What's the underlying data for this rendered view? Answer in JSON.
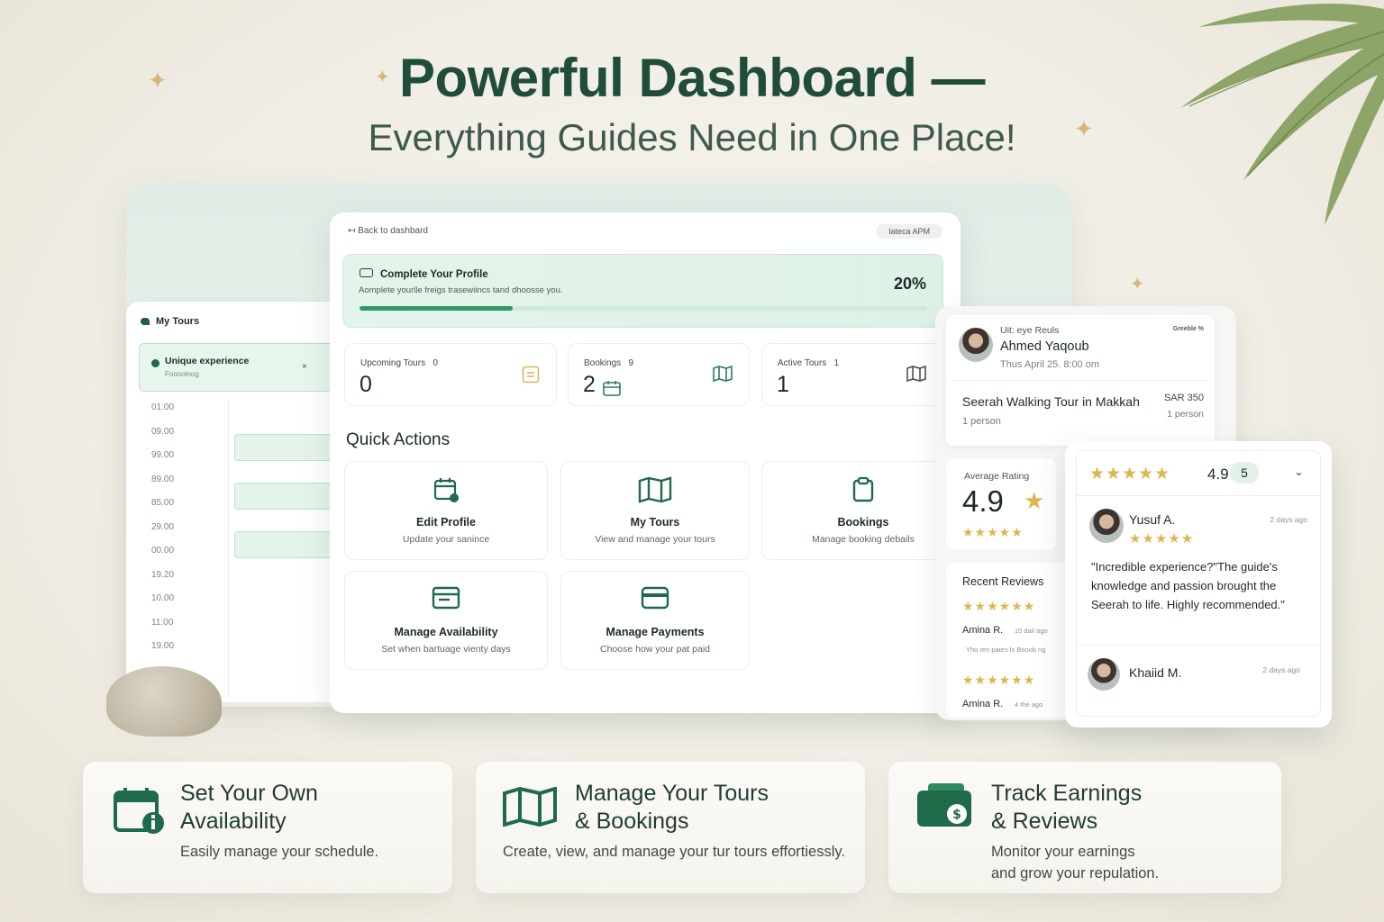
{
  "headline": {
    "title": "Powerful Dashboard —",
    "subtitle": "Everything Guides Need in One Place!"
  },
  "calendar": {
    "title": "My Tours",
    "card_title": "Unique experience",
    "card_sub": "Fooooinog",
    "card_close": "×",
    "times": [
      "01:00",
      "09.00",
      "99.00",
      "89.00",
      "85.00",
      "29.00",
      "00.00",
      "19.20",
      "10.00",
      "11:00",
      "19.00"
    ]
  },
  "dashboard": {
    "back_label": "↤ Back to dashbard",
    "latest_label": "lateca APM",
    "profile": {
      "title": "Complete Your Profile",
      "subtitle": "Aomplete yourlle freigs trasewiincs tand dhoosse you.",
      "percent_label": "20%",
      "progress": 0.27
    },
    "stats": [
      {
        "label": "Upcoming Tours",
        "count": "0",
        "value": "0"
      },
      {
        "label": "Bookings",
        "count": "9",
        "value": "2"
      },
      {
        "label": "Active Tours",
        "count": "1",
        "value": "1"
      }
    ],
    "quick_actions_title": "Quick Actions",
    "quick_actions": [
      {
        "title": "Edit Profile",
        "sub": "Update your sanince",
        "icon": "calendar-edit-icon"
      },
      {
        "title": "My Tours",
        "sub": "View and manage your tours",
        "icon": "map-icon"
      },
      {
        "title": "Bookings",
        "sub": "Manage booking debails",
        "icon": "clipboard-icon"
      },
      {
        "title": "Manage Availability",
        "sub": "Set when bartuage vienty days",
        "icon": "availability-icon"
      },
      {
        "title": "Manage Payments",
        "sub": "Choose how your pat paid",
        "icon": "card-icon"
      }
    ]
  },
  "booking": {
    "label": "Uit: eye Reuls",
    "badge": "Greeble %",
    "name": "Ahmed Yaqoub",
    "date": "Thus April 25. 8:00 om",
    "tour": "Seerah Walking Tour in Makkah",
    "price": "SAR 350",
    "persons_left": "1 person",
    "persons_right": "1 person"
  },
  "average": {
    "label": "Average Rating",
    "value": "4.9",
    "rating": 5
  },
  "recent": {
    "title": "Recent Reviews",
    "items": [
      {
        "name": "Amina R.",
        "ago": "10 dail ago",
        "note": "Yho ren pates ls Booob ng"
      },
      {
        "name": "Amina R.",
        "ago": "4 the ago"
      }
    ]
  },
  "reviews": {
    "score": "4.9",
    "count": "5",
    "chevron": "⌄",
    "items": [
      {
        "name": "Yusuf A.",
        "ago": "2 days ago",
        "quote": "\"Incredible experience?\"The guide's knowledge and passion brought the Seerah to life. Highly recommended.\""
      },
      {
        "name": "Khaiid M.",
        "ago": "2 days ago"
      }
    ]
  },
  "features": [
    {
      "title_1": "Set Your Own",
      "title_2": "Availability",
      "sub_1": "Easily manage your schedule.",
      "sub_2": "",
      "icon": "calendar-info-icon"
    },
    {
      "title_1": "Manage Your Tours",
      "title_2": "& Bookings",
      "sub_1": "Create, view, and manage your tur tours effortiessly.",
      "sub_2": "",
      "icon": "map-icon"
    },
    {
      "title_1": "Track Earnings",
      "title_2": "& Reviews",
      "sub_1": "Monitor your earnings",
      "sub_2": "and grow your repulation.",
      "icon": "wallet-dollar-icon"
    }
  ],
  "colors": {
    "brand_green": "#1f4d3a",
    "accent_green": "#2f9a67",
    "star_gold": "#e0b54d",
    "sparkle_gold": "#d9b677"
  }
}
